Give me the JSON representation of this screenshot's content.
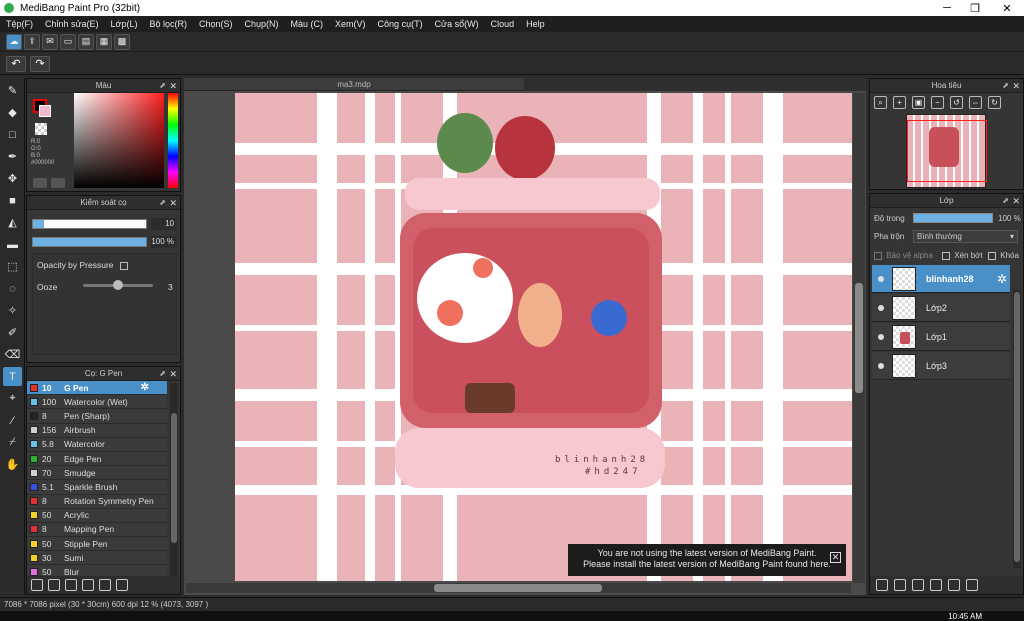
{
  "window": {
    "title": "MediBang Paint Pro (32bit)",
    "controls": [
      "─",
      "❐",
      "✕"
    ]
  },
  "menu": [
    "Tệp(F)",
    "Chỉnh sửa(E)",
    "Lớp(L)",
    "Bộ lọc(R)",
    "Chọn(S)",
    "Chụp(N)",
    "Màu (C)",
    "Xem(V)",
    "Công cụ(T)",
    "Cửa sổ(W)",
    "Cloud",
    "Help"
  ],
  "color_panel": {
    "title": "Màu",
    "rgb": {
      "r": "R:0",
      "g": "G:0",
      "b": "B:0",
      "hex": "#000000"
    }
  },
  "brush_control": {
    "title": "Kiểm soát cọ",
    "size_value": "10",
    "opacity_value": "100 %",
    "opacity_by_pressure": "Opacity by Pressure",
    "ooze_label": "Ooze",
    "ooze_value": "3",
    "size_fraction": 0.1,
    "opacity_fraction": 1.0
  },
  "brush_panel": {
    "title": "Cọ: G Pen",
    "items": [
      {
        "size": "10",
        "name": "G Pen",
        "color": "#e03030",
        "selected": true
      },
      {
        "size": "100",
        "name": "Watercolor (Wet)",
        "color": "#6cc0e8"
      },
      {
        "size": "8",
        "name": "Pen (Sharp)",
        "color": "#222222"
      },
      {
        "size": "156",
        "name": "Airbrush",
        "color": "#d0d0d0"
      },
      {
        "size": "5.8",
        "name": "Watercolor",
        "color": "#6cc0e8"
      },
      {
        "size": "20",
        "name": "Edge Pen",
        "color": "#30b030"
      },
      {
        "size": "70",
        "name": "Smudge",
        "color": "#d0d0d0"
      },
      {
        "size": "5.1",
        "name": "Sparkle Brush",
        "color": "#3050e0"
      },
      {
        "size": "8",
        "name": "Rotation Symmetry Pen",
        "color": "#e03030"
      },
      {
        "size": "50",
        "name": "Acrylic",
        "color": "#f0d020"
      },
      {
        "size": "8",
        "name": "Mapping Pen",
        "color": "#e03030"
      },
      {
        "size": "50",
        "name": "Stipple Pen",
        "color": "#f0d020"
      },
      {
        "size": "30",
        "name": "Sumi",
        "color": "#f0d020"
      },
      {
        "size": "50",
        "name": "Blur",
        "color": "#e070e0"
      }
    ]
  },
  "canvas": {
    "tab": "ma3.mdp",
    "signature_line1": "blinhanh28",
    "signature_line2": "#hd247"
  },
  "update_notice": {
    "line1": "You are not using the latest version of MediBang Paint.",
    "line2": "Please install the latest version of MediBang Paint found here.",
    "close": "✕"
  },
  "navigator": {
    "title": "Hoa tiêu"
  },
  "layer_panel": {
    "title": "Lớp",
    "opacity_label": "Độ trong",
    "opacity_value": "100 %",
    "blend_label": "Pha trộn",
    "blend_value": "Bình thường",
    "protect_alpha": "Bảo vệ alpha",
    "clipping": "Xén bớt",
    "lock": "Khóa",
    "layers": [
      {
        "name": "blinhanh28",
        "selected": true
      },
      {
        "name": "Lớp2"
      },
      {
        "name": "Lớp1"
      },
      {
        "name": "Lớp3"
      }
    ]
  },
  "status": "7086 * 7086 pixel  (30 * 30cm)  600 dpi  12 %  (4073, 3097 )",
  "clock": "10:45 AM"
}
